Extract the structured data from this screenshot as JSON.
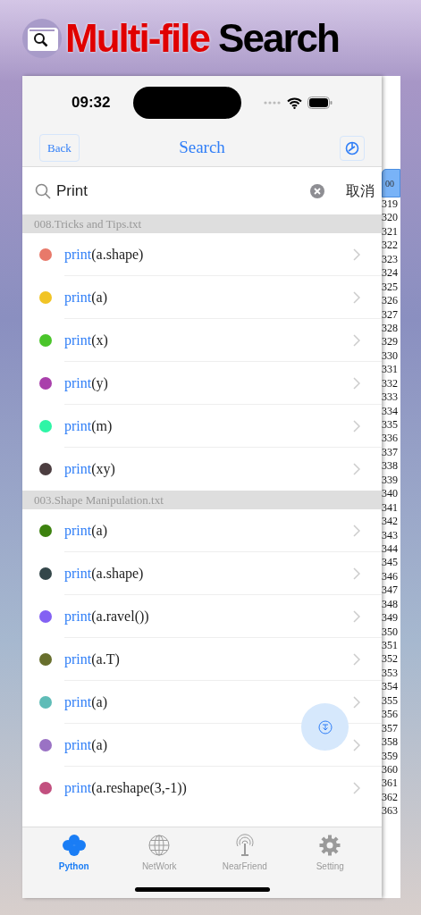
{
  "banner": {
    "highlight": "Multi-file",
    "text": "Search"
  },
  "status_bar": {
    "time": "09:32"
  },
  "nav": {
    "back": "Back",
    "title": "Search"
  },
  "search": {
    "value": "Print",
    "cancel": "取消"
  },
  "sections": [
    {
      "file": "008.Tricks and Tips.txt",
      "results": [
        {
          "match": "print",
          "text": "(a.shape)",
          "color": "#e8796a"
        },
        {
          "match": "print",
          "text": "(a)",
          "color": "#f1c425"
        },
        {
          "match": "print",
          "text": "(x)",
          "color": "#4ac52a"
        },
        {
          "match": "print",
          "text": "(y)",
          "color": "#a940ab"
        },
        {
          "match": "print",
          "text": "(m)",
          "color": "#2ef5a6"
        },
        {
          "match": "print",
          "text": "(xy)",
          "color": "#4c3d40"
        }
      ]
    },
    {
      "file": "003.Shape Manipulation.txt",
      "results": [
        {
          "match": "print",
          "text": "(a)",
          "color": "#3d820f"
        },
        {
          "match": "print",
          "text": "(a.shape)",
          "color": "#34474a"
        },
        {
          "match": "print",
          "text": "(a.ravel())",
          "color": "#8361f3"
        },
        {
          "match": "print",
          "text": "(a.T)",
          "color": "#686f2d"
        },
        {
          "match": "print",
          "text": "(a)",
          "color": "#5fbcb7"
        },
        {
          "match": "print",
          "text": "(a)",
          "color": "#9a72c4"
        },
        {
          "match": "print",
          "text": "(a.reshape(3,-1))",
          "color": "#c2507f"
        }
      ]
    }
  ],
  "side_panel": {
    "tab": "00",
    "line_numbers": [
      "319",
      "320",
      "321",
      "322",
      "323",
      "324",
      "325",
      "326",
      "327",
      "328",
      "329",
      "330",
      "331",
      "332",
      "333",
      "334",
      "335",
      "336",
      "337",
      "338",
      "339",
      "340",
      "341",
      "342",
      "343",
      "344",
      "345",
      "346",
      "347",
      "348",
      "349",
      "350",
      "351",
      "352",
      "353",
      "354",
      "355",
      "356",
      "357",
      "358",
      "359",
      "360",
      "361",
      "362",
      "363"
    ]
  },
  "tabs": [
    {
      "label": "Python",
      "kind": "python",
      "selected": true
    },
    {
      "label": "NetWork",
      "kind": "globe",
      "selected": false
    },
    {
      "label": "NearFriend",
      "kind": "antenna",
      "selected": false
    },
    {
      "label": "Setting",
      "kind": "gear",
      "selected": false
    }
  ]
}
